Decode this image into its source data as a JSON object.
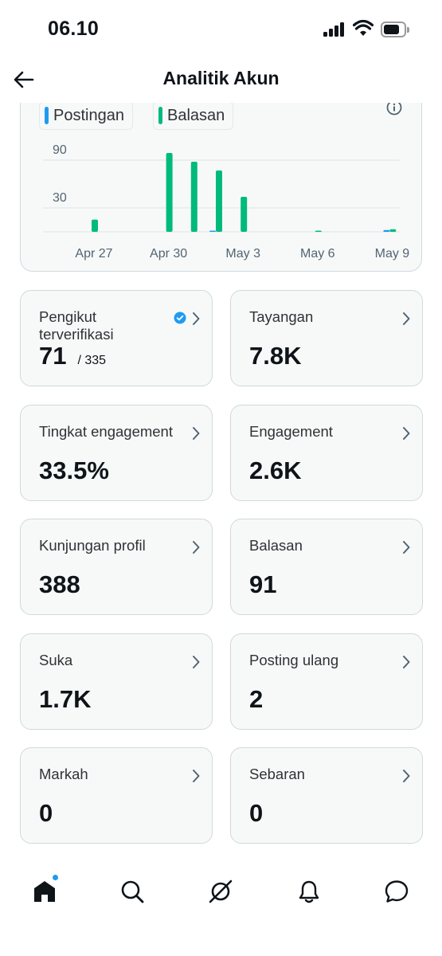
{
  "status_bar": {
    "time": "06.10"
  },
  "header": {
    "title": "Analitik Akun"
  },
  "chart": {
    "legend": [
      {
        "label": "Postingan",
        "color": "#1d9bf0"
      },
      {
        "label": "Balasan",
        "color": "#00ba7c"
      }
    ]
  },
  "chart_data": {
    "type": "bar",
    "y_ticks": [
      "90",
      "30"
    ],
    "x_ticks": [
      "Apr 27",
      "Apr 30",
      "May 3",
      "May 6",
      "May 9"
    ],
    "categories": [
      "Apr 27",
      "Apr 28",
      "Apr 29",
      "Apr 30",
      "May 1",
      "May 2",
      "May 3",
      "May 4",
      "May 5",
      "May 6",
      "May 7",
      "May 8",
      "May 9"
    ],
    "series": [
      {
        "name": "Postingan",
        "color": "#1d9bf0",
        "values": [
          0,
          0,
          0,
          0,
          0,
          1,
          0,
          0,
          0,
          0,
          0,
          0,
          2
        ]
      },
      {
        "name": "Balasan",
        "color": "#00ba7c",
        "values": [
          14,
          0,
          0,
          90,
          80,
          70,
          40,
          0,
          0,
          1,
          0,
          0,
          3
        ]
      }
    ],
    "ylim": [
      0,
      100
    ]
  },
  "metrics": [
    {
      "label": "Pengikut terverifikasi",
      "value": "71",
      "sub": "/ 335"
    },
    {
      "label": "Tayangan",
      "value": "7.8K"
    },
    {
      "label": "Tingkat engagement",
      "value": "33.5%"
    },
    {
      "label": "Engagement",
      "value": "2.6K"
    },
    {
      "label": "Kunjungan profil",
      "value": "388"
    },
    {
      "label": "Balasan",
      "value": "91"
    },
    {
      "label": "Suka",
      "value": "1.7K"
    },
    {
      "label": "Posting ulang",
      "value": "2"
    },
    {
      "label": "Markah",
      "value": "0"
    },
    {
      "label": "Sebaran",
      "value": "0"
    }
  ],
  "nav": [
    "home-icon",
    "search-icon",
    "grok-icon",
    "bell-icon",
    "messages-icon"
  ]
}
